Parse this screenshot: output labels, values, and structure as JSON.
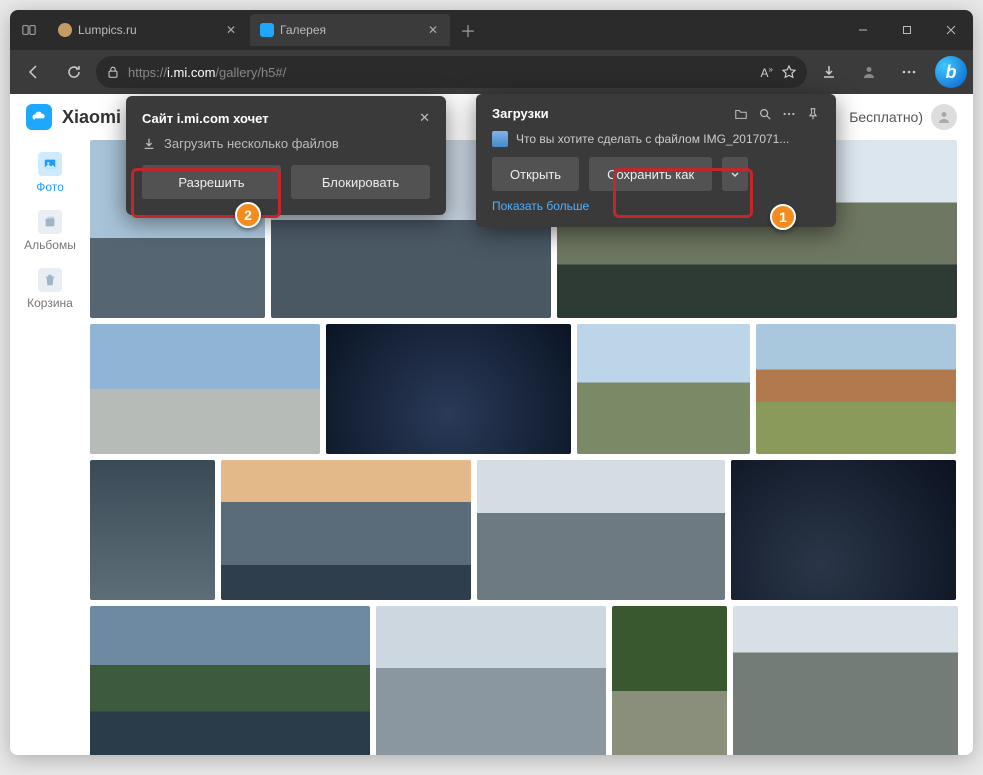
{
  "tabs": [
    {
      "title": "Lumpics.ru",
      "favicon_color": "#c69b63"
    },
    {
      "title": "Галерея",
      "favicon_color": "#1ea7ff"
    }
  ],
  "newtab_glyph": "＋",
  "url": {
    "proto": "https://",
    "host": "i.mi.com",
    "path": "/gallery/h5#/"
  },
  "header": {
    "brand": "Xiaomi",
    "right_label": "Бесплатно)"
  },
  "sidebar": {
    "items": [
      {
        "label": "Фото"
      },
      {
        "label": "Альбомы"
      },
      {
        "label": "Корзина"
      }
    ]
  },
  "permission_popup": {
    "title": "Сайт i.mi.com хочет",
    "request": "Загрузить несколько файлов",
    "allow": "Разрешить",
    "block": "Блокировать"
  },
  "downloads_popup": {
    "title": "Загрузки",
    "file_line": "Что вы хотите сделать с файлом IMG_2017071...",
    "open": "Открыть",
    "save_as": "Сохранить как",
    "show_more": "Показать больше"
  },
  "callouts": {
    "one": "1",
    "two": "2"
  }
}
